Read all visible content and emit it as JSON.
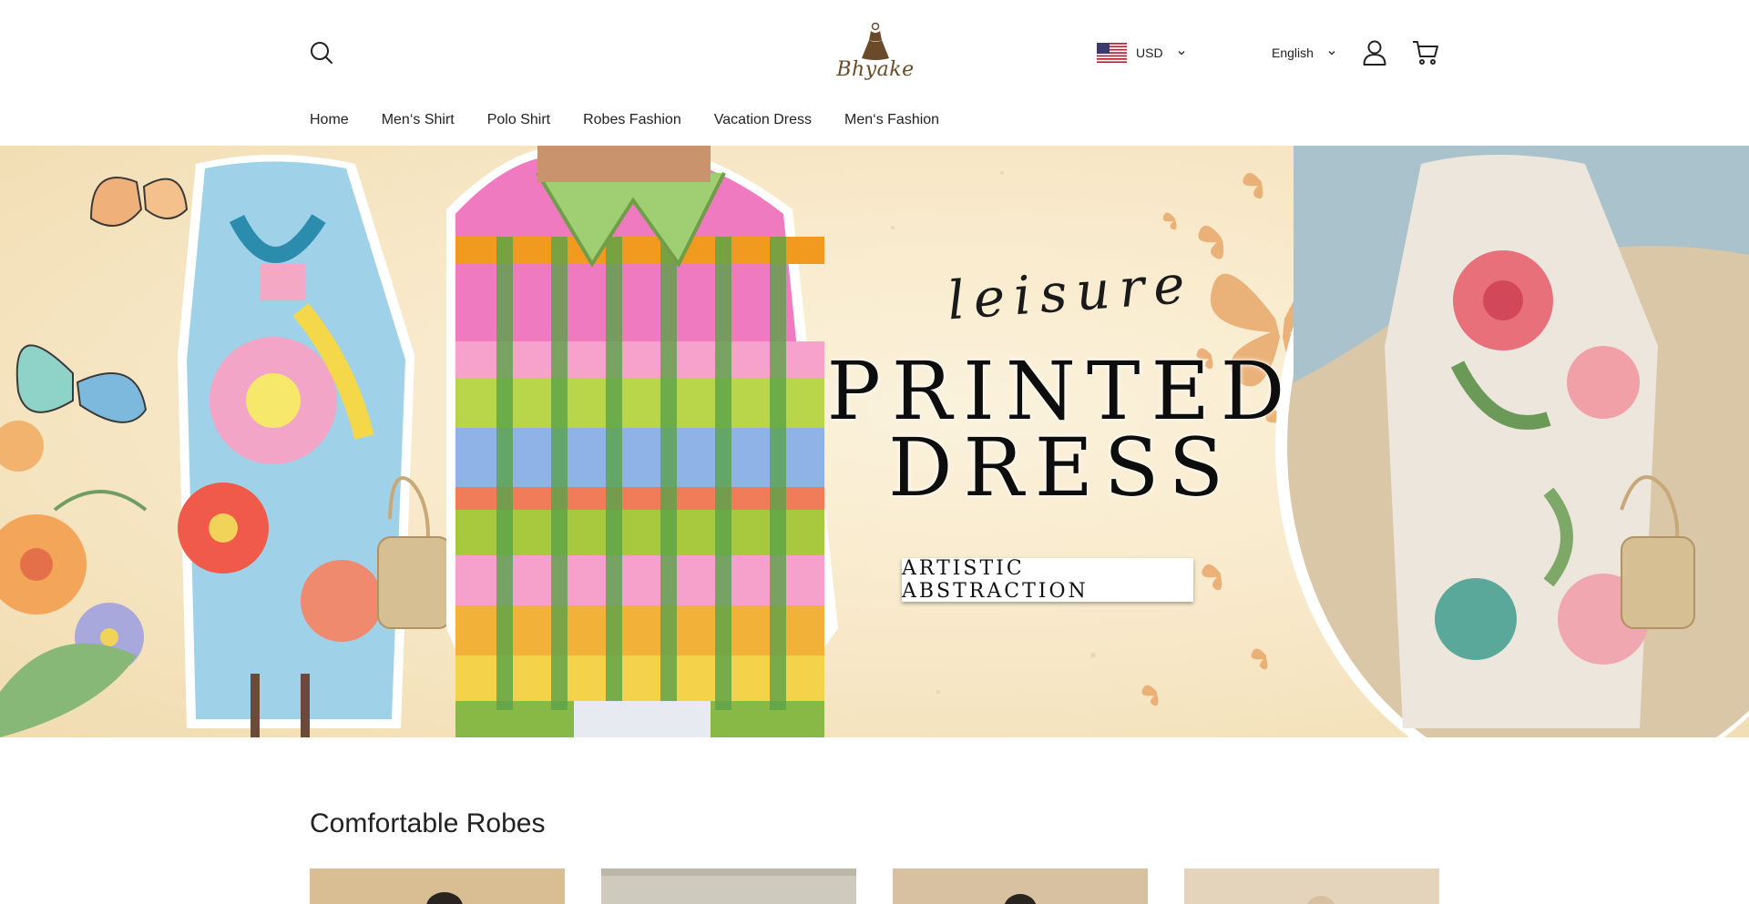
{
  "header": {
    "logo_text": "Bhyake",
    "currency": {
      "label": "USD",
      "flag_icon": "us-flag-icon"
    },
    "language": {
      "label": "English"
    },
    "icons": [
      "search-icon",
      "user-icon",
      "cart-icon",
      "chevron-down-icon"
    ]
  },
  "nav": {
    "items": [
      {
        "label": "Home"
      },
      {
        "label": "Men‘s Shirt"
      },
      {
        "label": "Polo Shirt"
      },
      {
        "label": "Robes Fashion"
      },
      {
        "label": "Vacation Dress"
      },
      {
        "label": "Men‘s Fashion"
      }
    ]
  },
  "hero": {
    "tagline": "leisure",
    "title_line1": "PRINTED",
    "title_line2": "DRESS",
    "badge": "ARTISTIC ABSTRACTION",
    "colors": {
      "background": "#f7e7c6",
      "butterfly": "#e8a86a",
      "sand": "#d9c7a8",
      "sea": "#a9c2cc"
    }
  },
  "section": {
    "title": "Comfortable Robes",
    "product_tiles": [
      {
        "color": "#d9bd93"
      },
      {
        "color": "#cfcabe"
      },
      {
        "color": "#d8c1a0"
      },
      {
        "color": "#e4d4bb"
      }
    ]
  }
}
